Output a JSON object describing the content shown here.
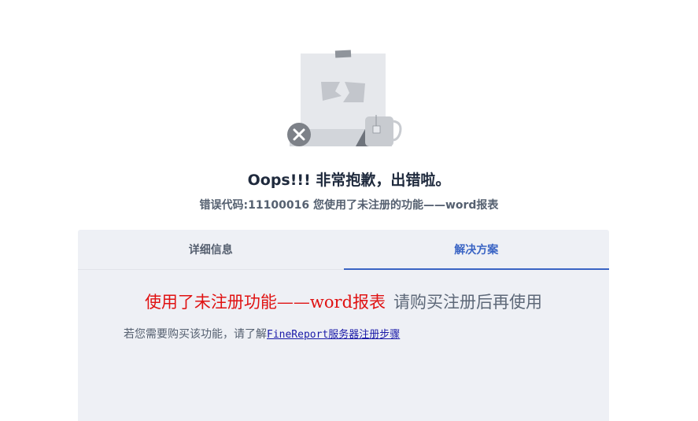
{
  "error": {
    "title": "Oops!!! 非常抱歉，出错啦。",
    "code_line": "错误代码:11100016 您使用了未注册的功能——word报表"
  },
  "tabs": [
    {
      "label": "详细信息",
      "active": false
    },
    {
      "label": "解决方案",
      "active": true
    }
  ],
  "solution": {
    "notice_red": "使用了未注册功能——word报表",
    "notice_gray": "请购买注册后再使用",
    "purchase_prefix": "若您需要购买该功能，请了解",
    "purchase_link": "FineReport服务器注册步骤"
  },
  "colors": {
    "accent": "#3a64c4",
    "error_red": "#e01212",
    "panel_bg": "#eef0f5"
  },
  "icons": [
    "broken-page-illustration",
    "close-icon",
    "mug-icon"
  ]
}
